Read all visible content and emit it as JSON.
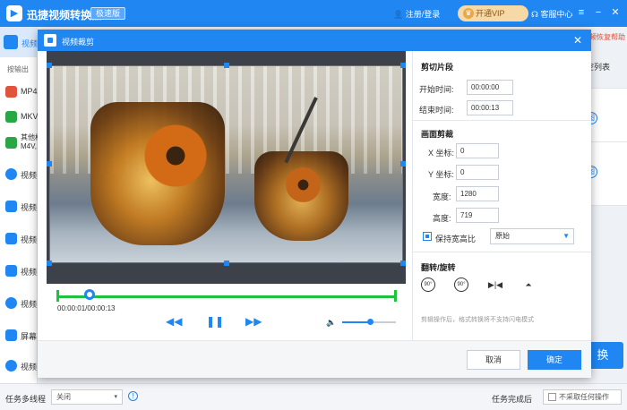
{
  "app": {
    "title": "迅捷视频转换器",
    "badge": "极速版",
    "login": "注册/登录",
    "vip": "开通VIP",
    "service": "客服中心"
  },
  "window_controls": {
    "menu": "≡",
    "minimize": "−",
    "close": "✕"
  },
  "leftbar": {
    "top": "视频",
    "sub": "按输出",
    "items": [
      {
        "label": "MP4",
        "color": "#e0533d"
      },
      {
        "label": "MKV",
        "color": "#29a745"
      },
      {
        "label": "其他格",
        "color": "#29a745",
        "label2": "M4V,"
      },
      {
        "label": "视频",
        "color": "#1f86f2"
      },
      {
        "label": "视频",
        "color": "#1f86f2"
      },
      {
        "label": "视频",
        "color": "#1f86f2"
      },
      {
        "label": "视频",
        "color": "#1f86f2"
      },
      {
        "label": "视频",
        "color": "#1f86f2"
      },
      {
        "label": "屏幕",
        "color": "#1f86f2"
      },
      {
        "label": "视频",
        "color": "#1f86f2"
      }
    ]
  },
  "rightbg": {
    "link": "音频恢复帮助",
    "clear": "空列表",
    "pill": "图",
    "convert": "换"
  },
  "bottom": {
    "multithread_label": "任务多线程",
    "multithread_value": "关闭",
    "done_label": "任务完成后",
    "done_option": "不采取任何操作"
  },
  "dialog": {
    "title": "视频裁剪",
    "time": {
      "current": "00:00:01",
      "total": "00:00:13",
      "display": "00:00:01/00:00:13"
    },
    "controls": {
      "prev": "◀◀",
      "pause": "❚❚",
      "next": "▶▶",
      "volume": "🔈"
    },
    "clip": {
      "title": "剪切片段",
      "start_label": "开始时间:",
      "start_value": "00:00:00",
      "end_label": "结束时间:",
      "end_value": "00:00:13"
    },
    "crop": {
      "title": "画面剪裁",
      "x_label": "X 坐标:",
      "x_value": "0",
      "y_label": "Y 坐标:",
      "y_value": "0",
      "w_label": "宽度:",
      "w_value": "1280",
      "h_label": "高度:",
      "h_value": "719",
      "keep_ratio_label": "保持宽高比",
      "ratio_value": "原始"
    },
    "flip": {
      "title": "翻转/旋转",
      "rotate_left": "90°",
      "rotate_right": "90°",
      "flip_h": "▶|◀",
      "flip_v": "⏶"
    },
    "note": "剪辑操作后，格式转换将不支持闪电模式",
    "cancel": "取消",
    "ok": "确定"
  }
}
